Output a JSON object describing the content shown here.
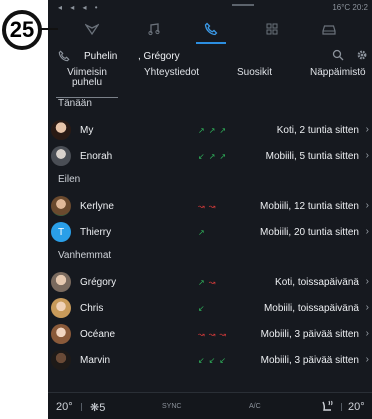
{
  "callout": "25",
  "status": {
    "left": "◂ ◂ ◂ •",
    "right": "16°C  20:2"
  },
  "header": {
    "phonebook_label": "Puhelin",
    "contact_label": ", Grégory"
  },
  "tabs": [
    {
      "label": "Viimeisin puhelu",
      "line1": "Viimeisin",
      "line2": "puhelu",
      "active": true
    },
    {
      "label": "Yhteystiedot",
      "active": false
    },
    {
      "label": "Suosikit",
      "active": false
    },
    {
      "label": "Näppäimistö",
      "active": false
    }
  ],
  "sections": [
    {
      "title": "Tänään",
      "rows": [
        {
          "name": "My",
          "avatar": "photo-woman-dark",
          "calls": [
            "out",
            "out",
            "out"
          ],
          "detail": "Koti, 2 tuntia sitten"
        },
        {
          "name": "Enorah",
          "avatar": "photo-person-grey",
          "calls": [
            "in",
            "out",
            "out"
          ],
          "detail": "Mobiili, 5 tuntia sitten"
        }
      ]
    },
    {
      "title": "Eilen",
      "rows": [
        {
          "name": "Kerlyne",
          "avatar": "photo-woman-green",
          "calls": [
            "miss",
            "miss"
          ],
          "detail": "Mobiili, 12 tuntia sitten"
        },
        {
          "name": "Thierry",
          "avatar": "letter",
          "letter": "T",
          "calls": [
            "out"
          ],
          "detail": "Mobiili, 20 tuntia sitten"
        }
      ]
    },
    {
      "title": "Vanhemmat",
      "rows": [
        {
          "name": "Grégory",
          "avatar": "photo-man-light",
          "calls": [
            "out",
            "miss"
          ],
          "detail": "Koti, toissapäivänä"
        },
        {
          "name": "Chris",
          "avatar": "photo-woman-blonde",
          "calls": [
            "in"
          ],
          "detail": "Mobiili, toissapäivänä"
        },
        {
          "name": "Océane",
          "avatar": "photo-woman-brown",
          "calls": [
            "miss",
            "miss",
            "miss"
          ],
          "detail": "Mobiili, 3 päivää sitten"
        },
        {
          "name": "Marvin",
          "avatar": "photo-man-dark",
          "calls": [
            "in",
            "in",
            "in"
          ],
          "detail": "Mobiili, 3 päivää sitten"
        }
      ]
    }
  ],
  "bottom": {
    "temp_left": "20°",
    "fan_level": "5",
    "sync_label": "SYNC",
    "ac_label": "A/C",
    "temp_right": "20°"
  },
  "colors": {
    "accent": "#2c8ee0",
    "background": "#16191f",
    "outgoing": "#2fb05a",
    "missed": "#d23a3a",
    "letter_avatar": "#2a9fe8"
  }
}
